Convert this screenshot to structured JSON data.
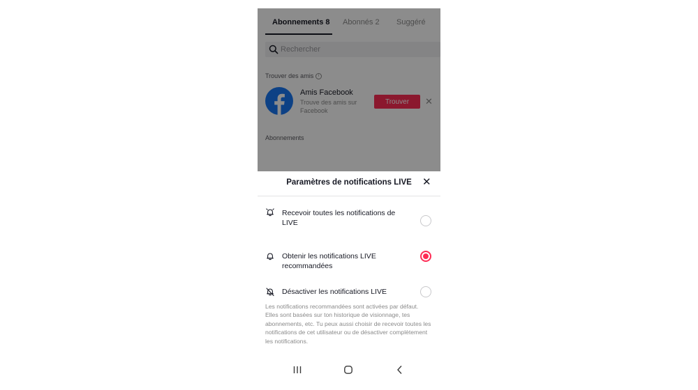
{
  "tabs": [
    {
      "label": "Abonnements 8",
      "active": true
    },
    {
      "label": "Abonnés 2",
      "active": false
    },
    {
      "label": "Suggéré",
      "active": false
    }
  ],
  "search": {
    "placeholder": "Rechercher"
  },
  "find_friends": {
    "section_label": "Trouver des amis",
    "facebook": {
      "title": "Amis Facebook",
      "subtitle": "Trouve des amis sur Facebook",
      "button_label": "Trouver"
    }
  },
  "subscriptions_label": "Abonnements",
  "sheet": {
    "title": "Paramètres de notifications LIVE",
    "options": [
      {
        "label": "Recevoir toutes les notifications de LIVE",
        "icon": "bell-ringing-icon",
        "selected": false
      },
      {
        "label": "Obtenir les notifications LIVE recommandées",
        "icon": "bell-icon",
        "selected": true
      },
      {
        "label": "Désactiver les notifications LIVE",
        "icon": "bell-off-icon",
        "selected": false
      }
    ],
    "footnote": "Les notifications recommandées sont activées par défaut. Elles sont basées sur ton historique de visionnage, tes abonnements, etc. Tu peux aussi choisir de recevoir toutes les notifications de cet utilisateur ou de désactiver complètement les notifications."
  },
  "colors": {
    "accent": "#fe2c55",
    "facebook": "#1877f2",
    "text": "#161823",
    "muted": "#8a8a8a"
  },
  "nav_icons": [
    "recent-apps-icon",
    "home-icon",
    "back-icon"
  ]
}
